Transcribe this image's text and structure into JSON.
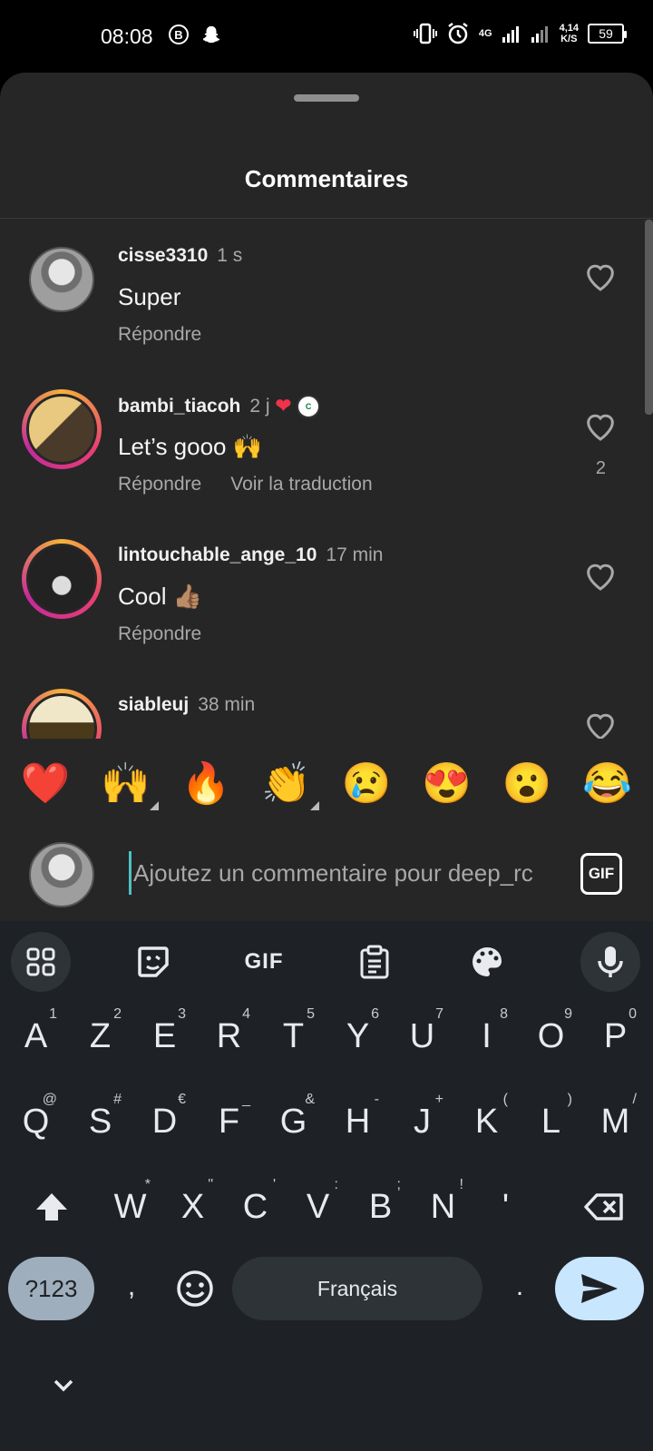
{
  "status_bar": {
    "time": "08:08",
    "network": "4G",
    "speed_top": "4,14",
    "speed_bottom": "K/S",
    "battery": "59"
  },
  "sheet": {
    "title": "Commentaires"
  },
  "comments": [
    {
      "user": "cisse3310",
      "time": "1 s",
      "text": "Super",
      "reply": "Répondre",
      "translate": "",
      "likes": ""
    },
    {
      "user": "bambi_tiacoh",
      "time": "2 j",
      "text": "Let’s gooo 🙌",
      "reply": "Répondre",
      "translate": "Voir la traduction",
      "likes": "2"
    },
    {
      "user": "lintouchable_ange_10",
      "time": "17 min",
      "text": "Cool 👍🏽",
      "reply": "Répondre",
      "translate": "",
      "likes": ""
    },
    {
      "user": "siableuj",
      "time": "38 min",
      "text": "",
      "reply": "",
      "translate": "",
      "likes": ""
    }
  ],
  "emoji_bar": [
    "❤️",
    "🙌",
    "🔥",
    "👏",
    "😢",
    "😍",
    "😮",
    "😂"
  ],
  "input": {
    "placeholder": "Ajoutez un commentaire pour deep_rc",
    "gif_label": "GIF"
  },
  "keyboard": {
    "toolbar_gif": "GIF",
    "row1": [
      [
        "A",
        "1"
      ],
      [
        "Z",
        "2"
      ],
      [
        "E",
        "3"
      ],
      [
        "R",
        "4"
      ],
      [
        "T",
        "5"
      ],
      [
        "Y",
        "6"
      ],
      [
        "U",
        "7"
      ],
      [
        "I",
        "8"
      ],
      [
        "O",
        "9"
      ],
      [
        "P",
        "0"
      ]
    ],
    "row2": [
      [
        "Q",
        "@"
      ],
      [
        "S",
        "#"
      ],
      [
        "D",
        "€"
      ],
      [
        "F",
        "_"
      ],
      [
        "G",
        "&"
      ],
      [
        "H",
        "-"
      ],
      [
        "J",
        "+"
      ],
      [
        "K",
        "("
      ],
      [
        "L",
        ")"
      ],
      [
        "M",
        "/"
      ]
    ],
    "row3": [
      [
        "W",
        "*"
      ],
      [
        "X",
        "\""
      ],
      [
        "C",
        "'"
      ],
      [
        "V",
        ":"
      ],
      [
        "B",
        ";"
      ],
      [
        "N",
        "!"
      ],
      [
        "'",
        ""
      ]
    ],
    "symbols_label": "?123",
    "comma": ",",
    "space_label": "Français",
    "period": "."
  }
}
